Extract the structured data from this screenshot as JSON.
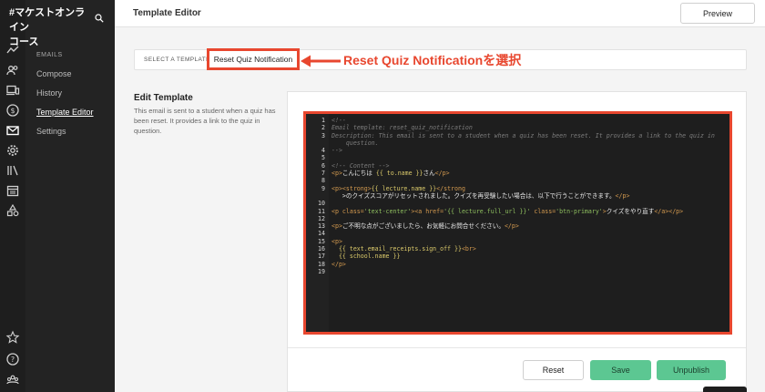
{
  "sidebar": {
    "brand": "#マケストオンライン\nコース",
    "section_label": "EMAILS",
    "items": [
      {
        "label": "Compose"
      },
      {
        "label": "History"
      },
      {
        "label": "Template Editor"
      },
      {
        "label": "Settings"
      }
    ]
  },
  "header": {
    "title": "Template Editor",
    "preview_label": "Preview"
  },
  "selector": {
    "label": "SELECT A TEMPLATE",
    "value": "Reset Quiz Notification"
  },
  "annotation": {
    "text": "Reset Quiz Notificationを選択",
    "color": "#e8472f"
  },
  "edit": {
    "heading": "Edit Template",
    "description": "This email is sent to a student when a quiz has been reset. It provides a link to the quiz in question."
  },
  "code": [
    {
      "n": "1",
      "text": "<!--"
    },
    {
      "n": "2",
      "text": "Email template: reset_quiz_notification"
    },
    {
      "n": "3",
      "text": "Description: This email is sent to a student when a quiz has been reset. It provides a link to the quiz in"
    },
    {
      "n": "",
      "text": "    question."
    },
    {
      "n": "4",
      "text": "-->"
    },
    {
      "n": "5",
      "text": ""
    },
    {
      "n": "6",
      "text": "<!-- Content -->"
    },
    {
      "n": "7",
      "text": "<p>こんにちは {{ to.name }}さん</p>"
    },
    {
      "n": "8",
      "text": ""
    },
    {
      "n": "9",
      "text": "<p><strong>{{ lecture.name }}</strong"
    },
    {
      "n": "",
      "text": "   >のクイズスコアがリセットされました。クイズを再受験したい場合は、以下で行うことができます。</p>"
    },
    {
      "n": "10",
      "text": ""
    },
    {
      "n": "11",
      "text": "<p class='text-center'><a href='{{ lecture.full_url }}' class='btn-primary'>クイズをやり直す</a></p>"
    },
    {
      "n": "12",
      "text": ""
    },
    {
      "n": "13",
      "text": "<p>ご不明な点がございましたら、お気軽にお問合せください。</p>"
    },
    {
      "n": "14",
      "text": ""
    },
    {
      "n": "15",
      "text": "<p>"
    },
    {
      "n": "16",
      "text": "  {{ text.email_receipts.sign_off }}<br>"
    },
    {
      "n": "17",
      "text": "  {{ school.name }}"
    },
    {
      "n": "18",
      "text": "</p>"
    },
    {
      "n": "19",
      "text": ""
    }
  ],
  "buttons": {
    "reset": "Reset",
    "save": "Save",
    "unpublish": "Unpublish"
  },
  "colors": {
    "accent": "#e8472f",
    "primary_green": "#5cc792",
    "sidebar_bg": "#232323"
  }
}
